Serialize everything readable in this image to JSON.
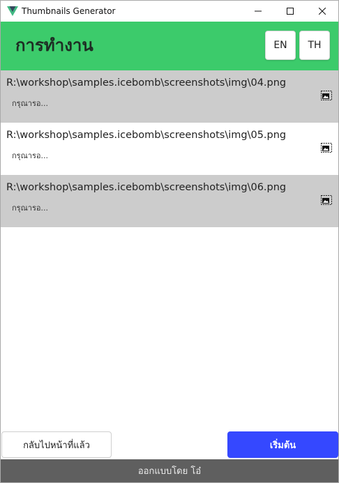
{
  "window": {
    "title": "Thumbnails Generator",
    "controls": [
      "minimize-icon",
      "maximize-icon",
      "close-icon"
    ]
  },
  "header": {
    "title": "การทำงาน",
    "languages": [
      "EN",
      "TH"
    ]
  },
  "items": [
    {
      "path": "R:\\workshop\\samples.icebomb\\screenshots\\img\\04.png",
      "status": "กรุณารอ...",
      "icon": "image-icon"
    },
    {
      "path": "R:\\workshop\\samples.icebomb\\screenshots\\img\\05.png",
      "status": "กรุณารอ...",
      "icon": "image-icon"
    },
    {
      "path": "R:\\workshop\\samples.icebomb\\screenshots\\img\\06.png",
      "status": "กรุณารอ...",
      "icon": "image-icon"
    }
  ],
  "actions": {
    "back_label": "กลับไปหน้าที่แล้ว",
    "start_label": "เริ่มต้น"
  },
  "footer": {
    "text": "ออกแบบโดย โอ๋"
  },
  "colors": {
    "header": "#3ccb6b",
    "row_alt": "#cccccc",
    "primary": "#3548ff",
    "footer": "#5f5f5f"
  }
}
